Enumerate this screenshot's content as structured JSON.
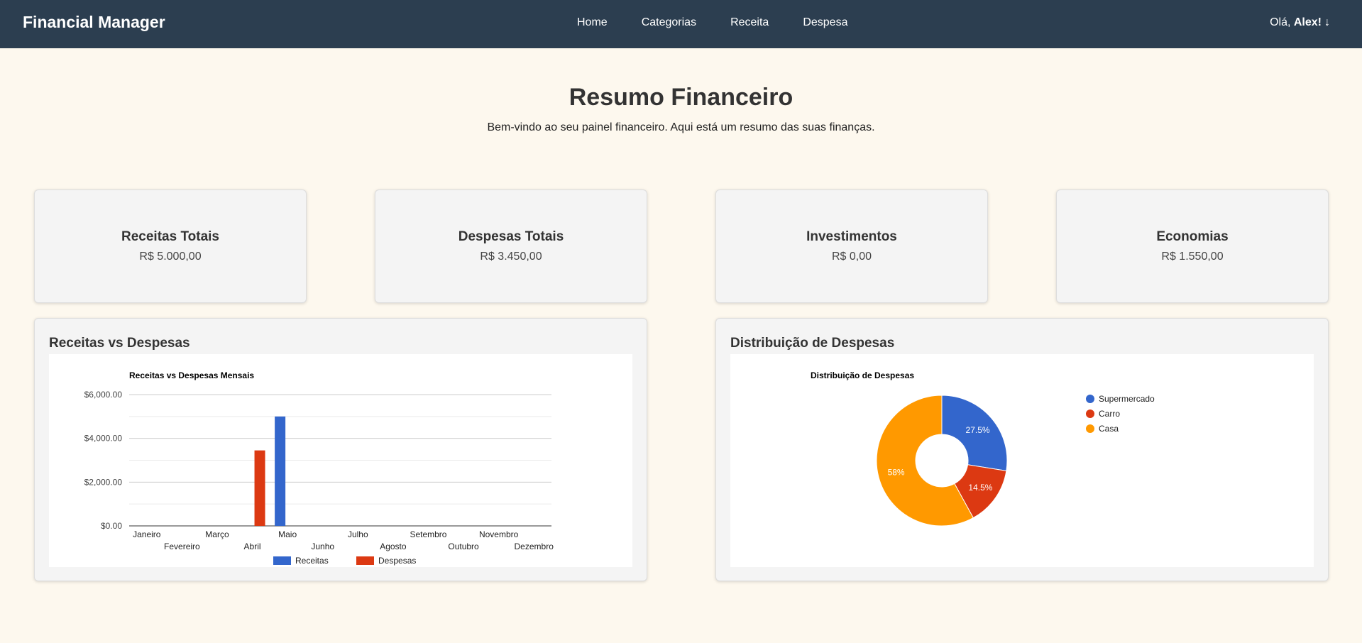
{
  "nav": {
    "brand": "Financial Manager",
    "links": [
      "Home",
      "Categorias",
      "Receita",
      "Despesa"
    ],
    "greeting": "Olá, ",
    "user": "Alex!",
    "user_icon": "arrow-down-icon"
  },
  "header": {
    "title": "Resumo Financeiro",
    "subtitle": "Bem-vindo ao seu painel financeiro. Aqui está um resumo das suas finanças."
  },
  "cards": [
    {
      "title": "Receitas Totais",
      "value": "R$ 5.000,00"
    },
    {
      "title": "Despesas Totais",
      "value": "R$ 3.450,00"
    },
    {
      "title": "Investimentos",
      "value": "R$ 0,00"
    },
    {
      "title": "Economias",
      "value": "R$ 1.550,00"
    }
  ],
  "panels": {
    "bar_title": "Receitas vs Despesas",
    "pie_title": "Distribuição de Despesas"
  },
  "colors": {
    "navbar": "#2c3e50",
    "receitas": "#3366cc",
    "despesas": "#dc3912",
    "casa": "#ff9900"
  },
  "chart_data": [
    {
      "type": "bar",
      "title": "Receitas vs Despesas Mensais",
      "categories": [
        "Janeiro",
        "Fevereiro",
        "Março",
        "Abril",
        "Maio",
        "Junho",
        "Julho",
        "Agosto",
        "Setembro",
        "Outubro",
        "Novembro",
        "Dezembro"
      ],
      "series": [
        {
          "name": "Receitas",
          "color": "#3366cc",
          "values": [
            0,
            0,
            0,
            0,
            5000,
            0,
            0,
            0,
            0,
            0,
            0,
            0
          ]
        },
        {
          "name": "Despesas",
          "color": "#dc3912",
          "values": [
            0,
            0,
            0,
            3450,
            0,
            0,
            0,
            0,
            0,
            0,
            0,
            0
          ]
        }
      ],
      "yticks": [
        "$0.00",
        "$2,000.00",
        "$4,000.00",
        "$6,000.00"
      ],
      "ylim": [
        0,
        6000
      ],
      "grid": true,
      "legend": "bottom"
    },
    {
      "type": "pie",
      "title": "Distribuição de Despesas",
      "donut": true,
      "slices": [
        {
          "label": "Supermercado",
          "value": 27.5,
          "text": "27.5%",
          "color": "#3366cc"
        },
        {
          "label": "Carro",
          "value": 14.5,
          "text": "14.5%",
          "color": "#dc3912"
        },
        {
          "label": "Casa",
          "value": 58,
          "text": "58%",
          "color": "#ff9900"
        }
      ],
      "legend": "right"
    }
  ]
}
